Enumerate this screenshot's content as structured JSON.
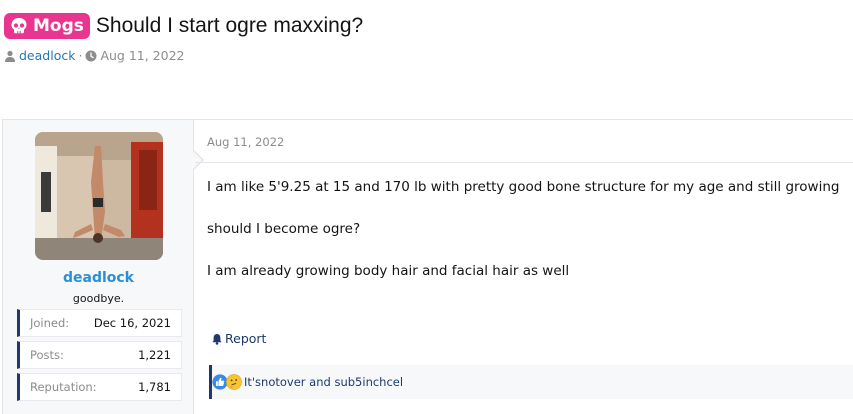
{
  "thread": {
    "prefix": "Mogs",
    "title": "Should I start ogre maxxing?",
    "author": "deadlock",
    "separator": "·",
    "date": "Aug 11, 2022"
  },
  "post": {
    "user": {
      "name": "deadlock",
      "title": "goodbye.",
      "stats": [
        {
          "label": "Joined:",
          "value": "Dec 16, 2021"
        },
        {
          "label": "Posts:",
          "value": "1,221"
        },
        {
          "label": "Reputation:",
          "value": "1,781"
        }
      ]
    },
    "date": "Aug 11, 2022",
    "body": [
      "I am like 5'9.25 at 15 and 170 lb with pretty good bone structure for my age and still growing",
      "should I become ogre?",
      "I am already growing body hair and facial hair as well"
    ],
    "report_label": "Report",
    "reactions": {
      "icons": [
        "like-icon",
        "thinking-icon"
      ],
      "users": "It'snotover and sub5inchcel"
    }
  },
  "colors": {
    "prefix_bg": "#e8358f",
    "link": "#2577b1",
    "username": "#2b8fd6",
    "accent_navy": "#1d3a6e"
  }
}
